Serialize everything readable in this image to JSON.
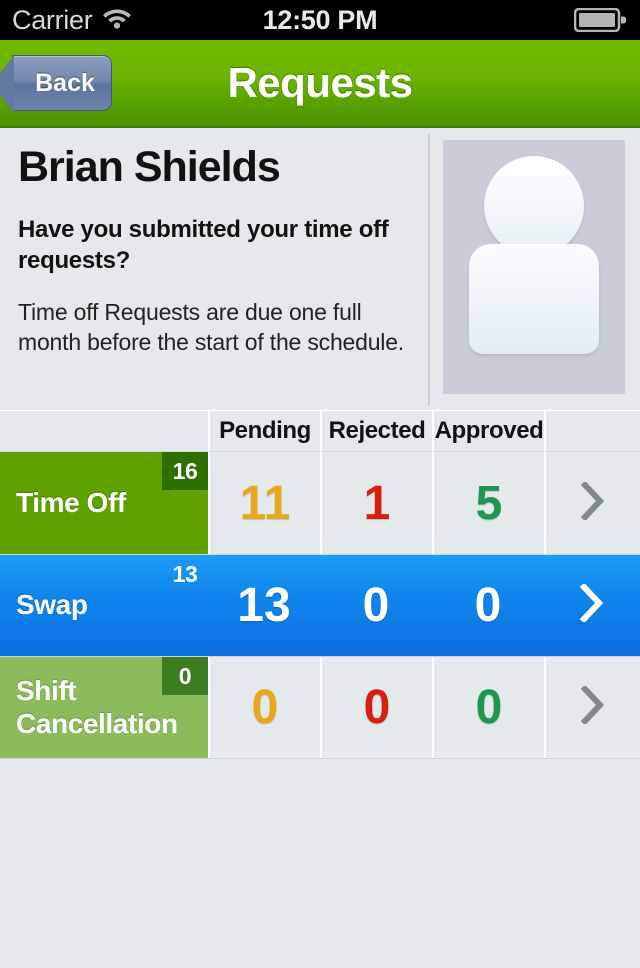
{
  "status_bar": {
    "carrier": "Carrier",
    "wifi_icon": "wifi-icon",
    "time": "12:50 PM",
    "battery_icon": "battery-icon"
  },
  "nav": {
    "back_label": "Back",
    "title": "Requests"
  },
  "info": {
    "person_name": "Brian Shields",
    "question": "Have you submitted your time off requests?",
    "body": "Time off Requests are due one full month before the start of the schedule.",
    "avatar_icon": "person-placeholder-icon"
  },
  "table": {
    "headers": {
      "label": "",
      "pending": "Pending",
      "rejected": "Rejected",
      "approved": "Approved",
      "arrow": ""
    },
    "rows": [
      {
        "label": "Time Off",
        "badge": "16",
        "pending": "11",
        "rejected": "1",
        "approved": "5",
        "chevron_icon": "chevron-right-icon",
        "selected": false
      },
      {
        "label": "Swap",
        "badge": "13",
        "pending": "13",
        "rejected": "0",
        "approved": "0",
        "chevron_icon": "chevron-right-icon",
        "selected": true
      },
      {
        "label": "Shift Cancellation",
        "badge": "0",
        "pending": "0",
        "rejected": "0",
        "approved": "0",
        "chevron_icon": "chevron-right-icon",
        "selected": false
      }
    ]
  },
  "colors": {
    "brand_green": "#5ea100",
    "nav_green": "#6cb400",
    "selected_blue": "#0f86ec",
    "pending_orange": "#e8a81e",
    "rejected_red": "#d81f12",
    "approved_green": "#1f9552",
    "background": "#e4eaec",
    "shift_row_green": "#8cbb5c"
  }
}
